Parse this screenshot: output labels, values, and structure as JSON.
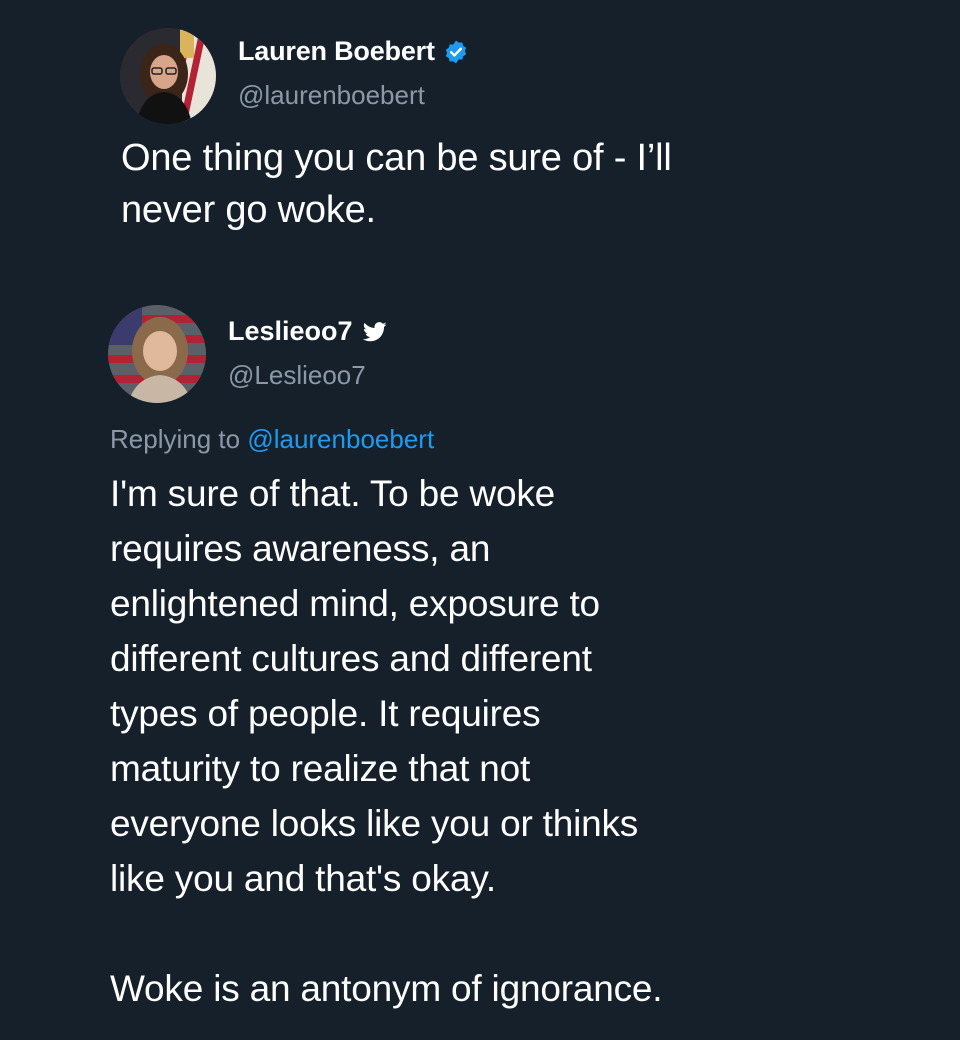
{
  "tweet": {
    "author_name": "Lauren Boebert",
    "author_handle": "@laurenboebert",
    "verified_icon": "verified-badge-icon",
    "text": "One thing you can be sure of - I’ll\nnever go woke."
  },
  "reply": {
    "author_name": "Leslieoo7",
    "author_handle": "@Leslieoo7",
    "badge_icon": "twitter-bird-icon",
    "replying_prefix": "Replying to",
    "replying_mention": "@laurenboebert",
    "text": "I'm sure of that. To be woke\nrequires awareness, an\nenlightened mind, exposure to\ndifferent cultures and different\ntypes of people. It requires\nmaturity to realize that not\neveryone looks like you or thinks\nlike you and that's okay.\n\nWoke is an antonym of ignorance."
  },
  "colors": {
    "background": "#15202b",
    "text": "#ffffff",
    "secondary": "#8b98a5",
    "accent": "#1d9bf0"
  }
}
